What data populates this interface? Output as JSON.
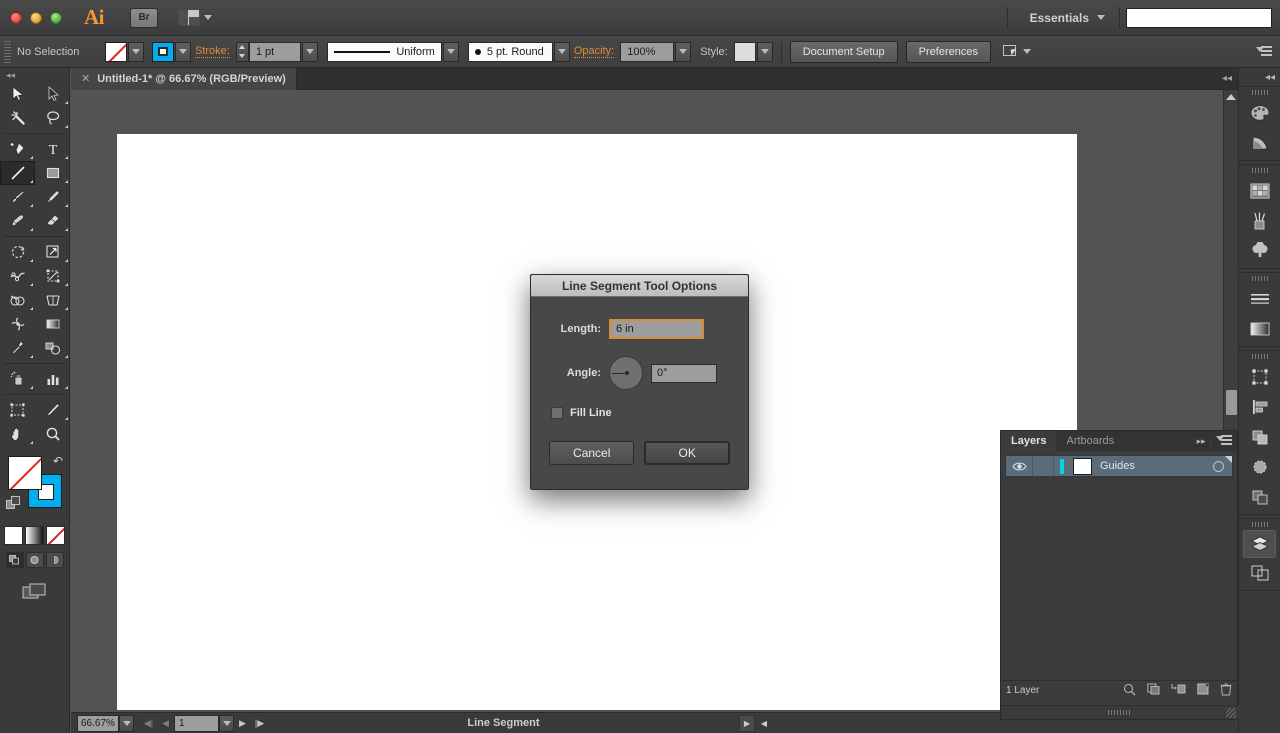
{
  "titlebar": {
    "app_logo": "Ai",
    "bridge_label": "Br",
    "bridge_icon": "bridge-icon",
    "arrange_icon": "arrange-documents-icon",
    "workspace": "Essentials",
    "workspace_caret_icon": "chevron-down-icon",
    "search_value": "",
    "search_placeholder": "",
    "window_controls": [
      "close",
      "minimize",
      "zoom"
    ]
  },
  "controlbar": {
    "selection_status": "No Selection",
    "fill_swatch_icon": "fill-none-swatch",
    "stroke_swatch_icon": "stroke-color-swatch",
    "stroke_label": "Stroke:",
    "stroke_weight": "1 pt",
    "stroke_profile": "Uniform",
    "brush_definition": "5 pt. Round",
    "opacity_label": "Opacity:",
    "opacity_value": "100%",
    "style_label": "Style:",
    "document_setup_label": "Document Setup",
    "preferences_label": "Preferences",
    "select_similar_icon": "select-similar-objects-icon",
    "panel_menu_icon": "panel-menu-icon"
  },
  "toolbox": {
    "tools": [
      {
        "name": "selection-tool",
        "selected": false
      },
      {
        "name": "direct-selection-tool",
        "selected": false
      },
      {
        "name": "magic-wand-tool",
        "selected": false
      },
      {
        "name": "lasso-tool",
        "selected": false
      },
      {
        "name": "pen-tool",
        "selected": false
      },
      {
        "name": "type-tool",
        "selected": false
      },
      {
        "name": "line-segment-tool",
        "selected": true
      },
      {
        "name": "rectangle-tool",
        "selected": false
      },
      {
        "name": "paintbrush-tool",
        "selected": false
      },
      {
        "name": "pencil-tool",
        "selected": false
      },
      {
        "name": "blob-brush-tool",
        "selected": false
      },
      {
        "name": "eraser-tool",
        "selected": false
      },
      {
        "name": "rotate-tool",
        "selected": false
      },
      {
        "name": "scale-tool",
        "selected": false
      },
      {
        "name": "width-tool",
        "selected": false
      },
      {
        "name": "free-transform-tool",
        "selected": false
      },
      {
        "name": "shape-builder-tool",
        "selected": false
      },
      {
        "name": "perspective-grid-tool",
        "selected": false
      },
      {
        "name": "mesh-tool",
        "selected": false
      },
      {
        "name": "gradient-tool",
        "selected": false
      },
      {
        "name": "eyedropper-tool",
        "selected": false
      },
      {
        "name": "blend-tool",
        "selected": false
      },
      {
        "name": "symbol-sprayer-tool",
        "selected": false
      },
      {
        "name": "column-graph-tool",
        "selected": false
      },
      {
        "name": "artboard-tool",
        "selected": false
      },
      {
        "name": "slice-tool",
        "selected": false
      },
      {
        "name": "hand-tool",
        "selected": false
      },
      {
        "name": "zoom-tool",
        "selected": false
      }
    ],
    "fill_icon": "fill-none-indicator",
    "stroke_icon": "stroke-color-indicator",
    "swap_icon": "swap-fill-stroke-icon",
    "default_icon": "default-fill-stroke-icon",
    "color_mode_icons": [
      "color-mode-icon",
      "gradient-mode-icon",
      "none-mode-icon"
    ],
    "draw_mode_icons": [
      "draw-normal-icon",
      "draw-behind-icon",
      "draw-inside-icon"
    ],
    "screen_mode_icon": "change-screen-mode-icon"
  },
  "document": {
    "tab_title": "Untitled-1* @ 66.67% (RGB/Preview)",
    "tab_close_icon": "close-icon",
    "collapse_icon": "collapse-panel-icon"
  },
  "statusbar": {
    "zoom_level": "66.67%",
    "zoom_dropdown_icon": "chevron-down-icon",
    "first_page_icon": "first-artboard-icon",
    "prev_page_icon": "previous-artboard-icon",
    "page_number": "1",
    "page_dropdown_icon": "chevron-down-icon",
    "next_page_icon": "next-artboard-icon",
    "last_page_icon": "last-artboard-icon",
    "status_text": "Line Segment",
    "status_menu_icon": "status-menu-icon",
    "hscroll_left_icon": "scroll-left-icon"
  },
  "dock": {
    "collapse_icon": "collapse-to-icons-icon",
    "groups": [
      {
        "items": [
          {
            "name": "color-panel-icon",
            "active": false
          },
          {
            "name": "color-guide-panel-icon",
            "active": false
          }
        ]
      },
      {
        "items": [
          {
            "name": "swatches-panel-icon",
            "active": false
          },
          {
            "name": "brushes-panel-icon",
            "active": false
          },
          {
            "name": "symbols-panel-icon",
            "active": false
          }
        ]
      },
      {
        "items": [
          {
            "name": "stroke-panel-icon",
            "active": false
          },
          {
            "name": "gradient-panel-icon",
            "active": false
          }
        ]
      },
      {
        "items": [
          {
            "name": "transform-panel-icon",
            "active": false
          },
          {
            "name": "align-panel-icon",
            "active": false
          },
          {
            "name": "pathfinder-panel-icon",
            "active": false
          },
          {
            "name": "transparency-panel-icon",
            "active": false
          },
          {
            "name": "appearance-panel-icon",
            "active": false
          }
        ]
      },
      {
        "items": [
          {
            "name": "layers-panel-icon",
            "active": true
          },
          {
            "name": "artboards-panel-icon",
            "active": false
          }
        ]
      }
    ]
  },
  "layers_panel": {
    "tabs": [
      {
        "label": "Layers",
        "active": true
      },
      {
        "label": "Artboards",
        "active": false
      }
    ],
    "expand_icon": "expand-panels-icon",
    "menu_icon": "panel-menu-icon",
    "rows": [
      {
        "visibility_icon": "eye-icon",
        "lock_icon": "lock-toggle",
        "color": "#00d2e8",
        "thumbnail": "layer-thumbnail",
        "name": "Guides",
        "target_icon": "target-circle-icon",
        "selected": true
      }
    ],
    "footer": {
      "count_label": "1 Layer",
      "icons": [
        "locate-object-icon",
        "make-clipping-mask-icon",
        "create-new-sublayer-icon",
        "create-new-layer-icon",
        "delete-selection-icon"
      ]
    },
    "resize_icon": "resize-grip-icon"
  },
  "dialog": {
    "title": "Line Segment Tool Options",
    "length_label": "Length:",
    "length_value": "6 in",
    "angle_label": "Angle:",
    "angle_dial_icon": "angle-dial",
    "angle_value": "0°",
    "fill_line_label": "Fill Line",
    "fill_line_checked": false,
    "cancel_label": "Cancel",
    "ok_label": "OK"
  },
  "colors": {
    "accent_orange": "#f59535",
    "link_orange": "#e08c3a",
    "stroke_cyan": "#00adef",
    "layer_cyan": "#00d2e8",
    "focus_border": "#d98a33",
    "panel_bg": "#3a3a3a",
    "canvas_bg": "#535353",
    "artboard_bg": "#ffffff",
    "layer_row_selected": "#5a6b7a"
  }
}
